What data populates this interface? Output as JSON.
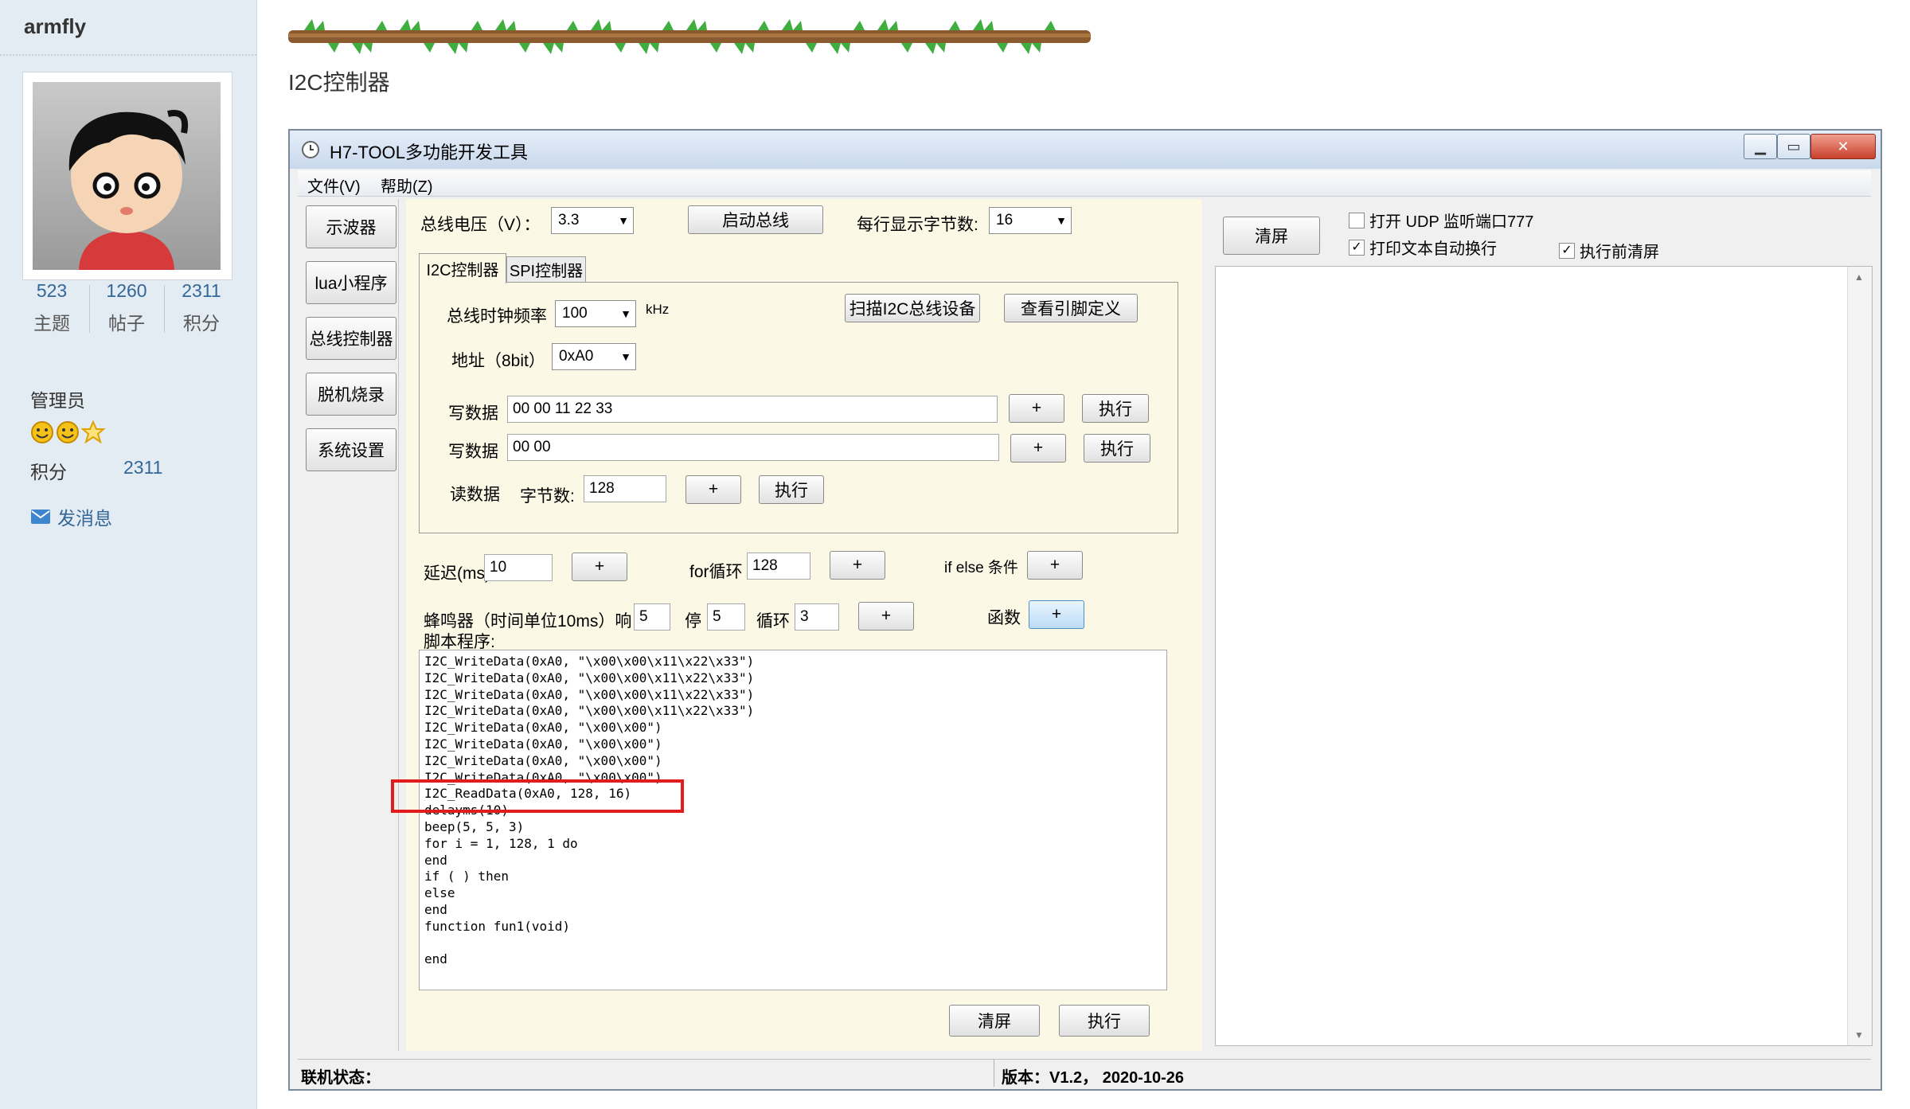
{
  "forum": {
    "username": "armfly",
    "stats": [
      {
        "value": "523",
        "label": "主题"
      },
      {
        "value": "1260",
        "label": "帖子"
      },
      {
        "value": "2311",
        "label": "积分"
      }
    ],
    "role": "管理员",
    "points_label": "积分",
    "points_value": "2311",
    "message_link": "发消息"
  },
  "post": {
    "title": "I2C控制器"
  },
  "app": {
    "window_title": "H7-TOOL多功能开发工具",
    "menu": [
      "文件(V)",
      "帮助(Z)"
    ],
    "nav": [
      "示波器",
      "lua小程序",
      "总线控制器",
      "脱机烧录",
      "系统设置"
    ],
    "bus_voltage_label": "总线电压（V）：",
    "bus_voltage_value": "3.3",
    "start_bus_button": "启动总线",
    "bytes_per_line_label": "每行显示字节数:",
    "bytes_per_line_value": "16",
    "tabs": [
      "I2C控制器",
      "SPI控制器"
    ],
    "i2c": {
      "clock_label": "总线时钟频率",
      "clock_value": "100",
      "clock_unit": "kHz",
      "scan_button": "扫描I2C总线设备",
      "pin_button": "查看引脚定义",
      "addr_label": "地址（8bit）",
      "addr_value": "0xA0",
      "write_label_1": "写数据",
      "write_value_1": "00 00 11 22 33",
      "write_label_2": "写数据",
      "write_value_2": "00 00",
      "read_label": "读数据",
      "byte_count_label": "字节数:",
      "byte_count_value": "128",
      "plus": "+",
      "exec": "执行"
    },
    "script_ctrl": {
      "delay_label": "延迟(ms)",
      "delay_value": "10",
      "for_label": "for循环",
      "for_value": "128",
      "ifelse_label": "if else 条件",
      "beep_label": "蜂鸣器（时间单位10ms）响",
      "beep_on": "5",
      "stop_label": "停",
      "beep_off": "5",
      "loop_label": "循环",
      "loop_value": "3",
      "func_label": "函数"
    },
    "script_label": "脚本程序:",
    "script_text": "I2C_WriteData(0xA0, \"\\x00\\x00\\x11\\x22\\x33\")\nI2C_WriteData(0xA0, \"\\x00\\x00\\x11\\x22\\x33\")\nI2C_WriteData(0xA0, \"\\x00\\x00\\x11\\x22\\x33\")\nI2C_WriteData(0xA0, \"\\x00\\x00\\x11\\x22\\x33\")\nI2C_WriteData(0xA0, \"\\x00\\x00\")\nI2C_WriteData(0xA0, \"\\x00\\x00\")\nI2C_WriteData(0xA0, \"\\x00\\x00\")\nI2C_WriteData(0xA0, \"\\x00\\x00\")\nI2C_ReadData(0xA0, 128, 16)\ndelayms(10)\nbeep(5, 5, 3)\nfor i = 1, 128, 1 do\nend\nif ( ) then\nelse\nend\nfunction fun1(void)\n\nend",
    "clear_button": "清屏",
    "run_button": "执行",
    "right": {
      "clear_button": "清屏",
      "udp_label": "打开 UDP 监听端口777",
      "wrap_label": "打印文本自动换行",
      "clear_before_label": "执行前清屏"
    },
    "status_label": "联机状态：",
    "version_text": "版本：V1.2， 2020-10-26"
  },
  "colors": {
    "highlight": "#e21c1c",
    "panel": "#fbf8e6",
    "link": "#336699"
  },
  "icons": [
    "clock-icon",
    "minimize-icon",
    "maximize-icon",
    "close-icon",
    "mail-icon",
    "smiley-medal-icon",
    "star-medal-icon",
    "dropdown-arrow-icon",
    "checkbox-icon"
  ]
}
